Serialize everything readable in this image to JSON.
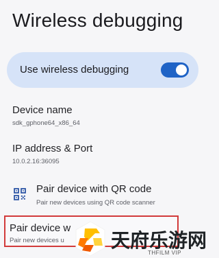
{
  "header": {
    "title": "Wireless debugging"
  },
  "main_toggle": {
    "label": "Use wireless debugging",
    "state": "on",
    "accent_color": "#1f63c6"
  },
  "device_name": {
    "title": "Device name",
    "value": "sdk_gphone64_x86_64"
  },
  "ip_port": {
    "title": "IP address & Port",
    "value": "10.0.2.16:36095"
  },
  "pair_qr": {
    "icon": "qr-code-icon",
    "title": "Pair device with QR code",
    "subtitle": "Pair new devices using QR code scanner"
  },
  "pair_code": {
    "title": "Pair device w",
    "subtitle": "Pair new devices u",
    "highlight_color": "#d23a3a"
  },
  "watermark": {
    "text": "天府乐游网",
    "subtext": "THFILM VIP"
  }
}
